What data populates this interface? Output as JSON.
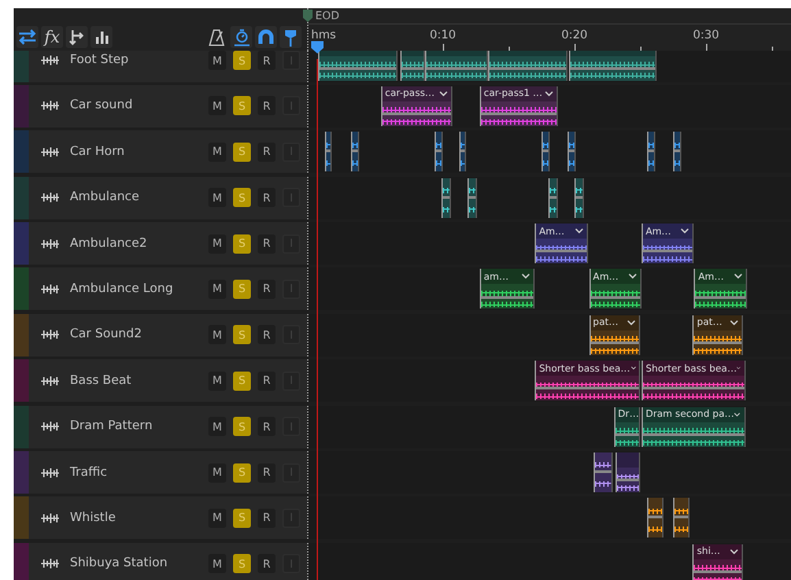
{
  "marker": {
    "label": "EOD"
  },
  "toolbar": {
    "effects_label": "fx"
  },
  "ruler": {
    "unit_label": "hms",
    "ticks": [
      {
        "label": "0:10"
      },
      {
        "label": "0:20"
      },
      {
        "label": "0:30"
      }
    ]
  },
  "tracks": [
    {
      "name": "Foot Step",
      "color": "#1d3b36",
      "buttons": [
        {
          "label": "M",
          "on": false,
          "enabled": true
        },
        {
          "label": "S",
          "on": true,
          "enabled": true
        },
        {
          "label": "R",
          "on": false,
          "enabled": true
        },
        {
          "label": "I",
          "enabled": false
        }
      ]
    },
    {
      "name": "Car sound",
      "color": "#3a1a3c",
      "buttons": [
        {
          "label": "M",
          "on": false,
          "enabled": true
        },
        {
          "label": "S",
          "on": true,
          "enabled": true
        },
        {
          "label": "R",
          "on": false,
          "enabled": true
        },
        {
          "label": "I",
          "enabled": false
        }
      ],
      "clips": [
        {
          "label": "car-pass…"
        },
        {
          "label": "car-pass1 …"
        }
      ]
    },
    {
      "name": "Car Horn",
      "color": "#1a2e48",
      "buttons": [
        {
          "label": "M",
          "on": false,
          "enabled": true
        },
        {
          "label": "S",
          "on": true,
          "enabled": true
        },
        {
          "label": "R",
          "on": false,
          "enabled": true
        },
        {
          "label": "I",
          "enabled": false
        }
      ]
    },
    {
      "name": "Ambulance",
      "color": "#1d3a36",
      "buttons": [
        {
          "label": "M",
          "on": false,
          "enabled": true
        },
        {
          "label": "S",
          "on": true,
          "enabled": true
        },
        {
          "label": "R",
          "on": false,
          "enabled": true
        },
        {
          "label": "I",
          "enabled": false
        }
      ]
    },
    {
      "name": "Ambulance2",
      "color": "#2a2a5a",
      "buttons": [
        {
          "label": "M",
          "on": false,
          "enabled": true
        },
        {
          "label": "S",
          "on": true,
          "enabled": true
        },
        {
          "label": "R",
          "on": false,
          "enabled": true
        },
        {
          "label": "I",
          "enabled": false
        }
      ],
      "clips": [
        {
          "label": "Am…"
        },
        {
          "label": "Am…"
        }
      ]
    },
    {
      "name": "Ambulance Long",
      "color": "#1c4428",
      "buttons": [
        {
          "label": "M",
          "on": false,
          "enabled": true
        },
        {
          "label": "S",
          "on": true,
          "enabled": true
        },
        {
          "label": "R",
          "on": false,
          "enabled": true
        },
        {
          "label": "I",
          "enabled": false
        }
      ],
      "clips": [
        {
          "label": "am…"
        },
        {
          "label": "Am…"
        },
        {
          "label": "Am…"
        }
      ]
    },
    {
      "name": "Car Sound2",
      "color": "#4a361a",
      "buttons": [
        {
          "label": "M",
          "on": false,
          "enabled": true
        },
        {
          "label": "S",
          "on": true,
          "enabled": true
        },
        {
          "label": "R",
          "on": false,
          "enabled": true
        },
        {
          "label": "I",
          "enabled": false
        }
      ],
      "clips": [
        {
          "label": "pat…"
        },
        {
          "label": "pat…"
        }
      ]
    },
    {
      "name": "Bass Beat",
      "color": "#4a1638",
      "buttons": [
        {
          "label": "M",
          "on": false,
          "enabled": true
        },
        {
          "label": "S",
          "on": true,
          "enabled": true
        },
        {
          "label": "R",
          "on": false,
          "enabled": true
        },
        {
          "label": "I",
          "enabled": false
        }
      ],
      "clips": [
        {
          "label": "Shorter bass bea…"
        },
        {
          "label": "Shorter bass bea…"
        }
      ]
    },
    {
      "name": "Dram Pattern",
      "color": "#1c3a30",
      "buttons": [
        {
          "label": "M",
          "on": false,
          "enabled": true
        },
        {
          "label": "S",
          "on": true,
          "enabled": true
        },
        {
          "label": "R",
          "on": false,
          "enabled": true
        },
        {
          "label": "I",
          "enabled": false
        }
      ],
      "clips": [
        {
          "label": "Dr…"
        },
        {
          "label": "Dram second pa…"
        }
      ]
    },
    {
      "name": "Traffic",
      "color": "#3a2450",
      "buttons": [
        {
          "label": "M",
          "on": false,
          "enabled": true
        },
        {
          "label": "S",
          "on": true,
          "enabled": true
        },
        {
          "label": "R",
          "on": false,
          "enabled": true
        },
        {
          "label": "I",
          "enabled": false
        }
      ]
    },
    {
      "name": "Whistle",
      "color": "#4a3818",
      "buttons": [
        {
          "label": "M",
          "on": false,
          "enabled": true
        },
        {
          "label": "S",
          "on": true,
          "enabled": true
        },
        {
          "label": "R",
          "on": false,
          "enabled": true
        },
        {
          "label": "I",
          "enabled": false
        }
      ]
    },
    {
      "name": "Shibuya Station",
      "color": "#4a1640",
      "buttons": [
        {
          "label": "M",
          "on": false,
          "enabled": true
        },
        {
          "label": "S",
          "on": true,
          "enabled": true
        },
        {
          "label": "R",
          "on": false,
          "enabled": true
        },
        {
          "label": "I",
          "enabled": false
        }
      ],
      "clips": [
        {
          "label": "shi…"
        }
      ]
    }
  ]
}
